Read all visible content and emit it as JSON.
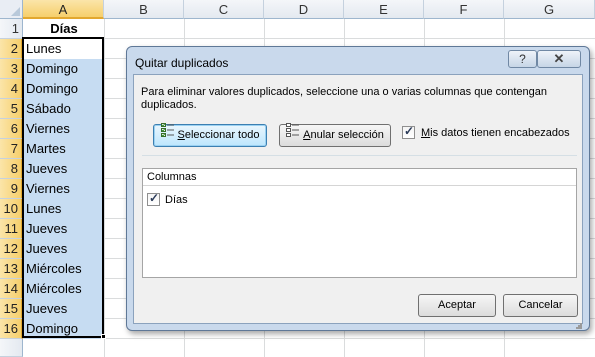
{
  "sheet": {
    "columns": [
      "A",
      "B",
      "C",
      "D",
      "E",
      "F",
      "G"
    ],
    "rows": [
      "1",
      "2",
      "3",
      "4",
      "5",
      "6",
      "7",
      "8",
      "9",
      "10",
      "11",
      "12",
      "13",
      "14",
      "15",
      "16"
    ],
    "cells_a": [
      "Días",
      "Lunes",
      "Domingo",
      "Domingo",
      "Sábado",
      "Viernes",
      "Martes",
      "Jueves",
      "Viernes",
      "Lunes",
      "Jueves",
      "Jueves",
      "Miércoles",
      "Miércoles",
      "Jueves",
      "Domingo"
    ]
  },
  "dialog": {
    "title": "Quitar duplicados",
    "help_label": "?",
    "close_label": "✕",
    "description": "Para eliminar valores duplicados, seleccione una o varias columnas que contengan duplicados.",
    "select_all": {
      "underline": "S",
      "rest": "eleccionar todo"
    },
    "unselect_all": {
      "underline": "A",
      "rest": "nular selección"
    },
    "has_headers": {
      "underline": "M",
      "rest": "is datos tienen encabezados",
      "checked": true
    },
    "columns_header": "Columnas",
    "column_items": [
      {
        "label": "Días",
        "checked": true
      }
    ],
    "ok_label": "Aceptar",
    "cancel_label": "Cancelar"
  },
  "colors": {
    "selection_fill": "#c6dcf2",
    "header_selected": "#f6cf6c",
    "dialog_frame": "#c9d9ec"
  }
}
